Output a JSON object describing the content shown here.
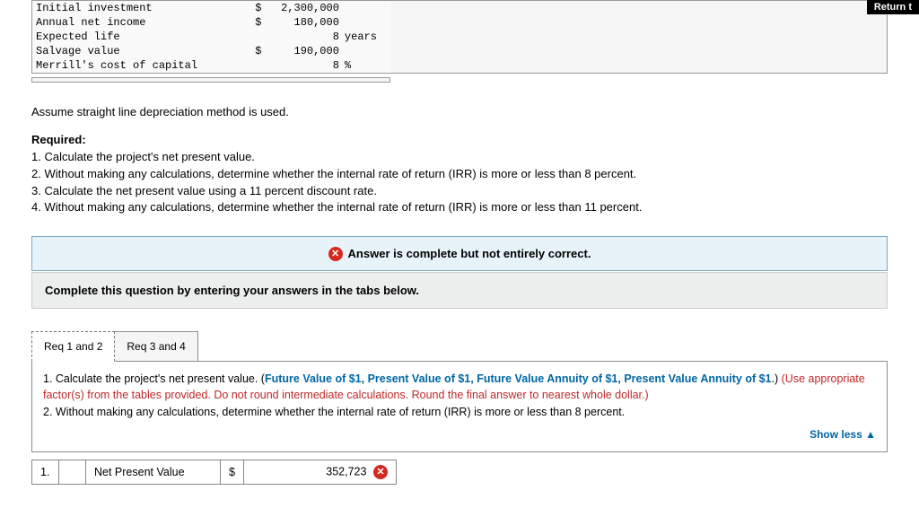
{
  "header": {
    "return": "Return t"
  },
  "facts": {
    "rows": [
      {
        "label": "Initial investment",
        "dollar": "$",
        "value": "2,300,000",
        "suffix": ""
      },
      {
        "label": "Annual net income",
        "dollar": "$",
        "value": "180,000",
        "suffix": ""
      },
      {
        "label": "Expected life",
        "dollar": "",
        "value": "8",
        "suffix": " years"
      },
      {
        "label": "Salvage value",
        "dollar": "$",
        "value": "190,000",
        "suffix": ""
      },
      {
        "label": "Merrill's cost of capital",
        "dollar": "",
        "value": "8",
        "suffix": "%"
      }
    ]
  },
  "assume": "Assume straight line depreciation method is used.",
  "required": {
    "heading": "Required:",
    "items": [
      "1. Calculate the project's net present value.",
      "2. Without making any calculations, determine whether the internal rate of return (IRR) is more or less than 8 percent.",
      "3. Calculate the net present value using a 11 percent discount rate.",
      "4. Without making any calculations, determine whether the internal rate of return (IRR) is more or less than 11 percent."
    ]
  },
  "banner": {
    "text": "Answer is complete but not entirely correct."
  },
  "complete_prompt": "Complete this question by entering your answers in the tabs below.",
  "tabs": {
    "tab1": "Req 1 and 2",
    "tab2": "Req 3 and 4"
  },
  "tab_body": {
    "part1_prefix": "1. Calculate the project's net present value. (",
    "link1": "Future Value of $1",
    "sep": ", ",
    "link2": "Present Value of $1",
    "link3": "Future Value Annuity of $1",
    "link4": "Present Value Annuity of $1",
    "part1_suffix": ".) ",
    "red": "(Use appropriate factor(s) from the tables provided. Do not round intermediate calculations. Round the final answer to nearest whole dollar.)",
    "part2": "2. Without making any calculations, determine whether the internal rate of return (IRR) is more or less than 8 percent.",
    "show_less": "Show less"
  },
  "answer": {
    "number": "1.",
    "label": "Net Present Value",
    "dollar": "$",
    "value": "352,723"
  }
}
